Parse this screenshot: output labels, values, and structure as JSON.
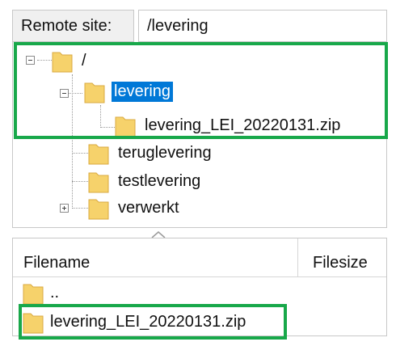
{
  "address_bar": {
    "label": "Remote site:",
    "path": "/levering"
  },
  "tree": {
    "root": {
      "label": "/"
    },
    "items": [
      {
        "label": "levering",
        "selected": true,
        "expanded": true
      },
      {
        "label": "levering_LEI_20220131.zip"
      },
      {
        "label": "teruglevering"
      },
      {
        "label": "testlevering"
      },
      {
        "label": "verwerkt",
        "expandable": true
      }
    ]
  },
  "file_list": {
    "columns": [
      "Filename",
      "Filesize"
    ],
    "rows": [
      {
        "name": ".."
      },
      {
        "name": "levering_LEI_20220131.zip"
      }
    ]
  },
  "colors": {
    "folder_fill": "#f6d26b",
    "folder_stroke": "#d9a940",
    "selection": "#0078d7",
    "highlight_box": "#18a84a"
  }
}
